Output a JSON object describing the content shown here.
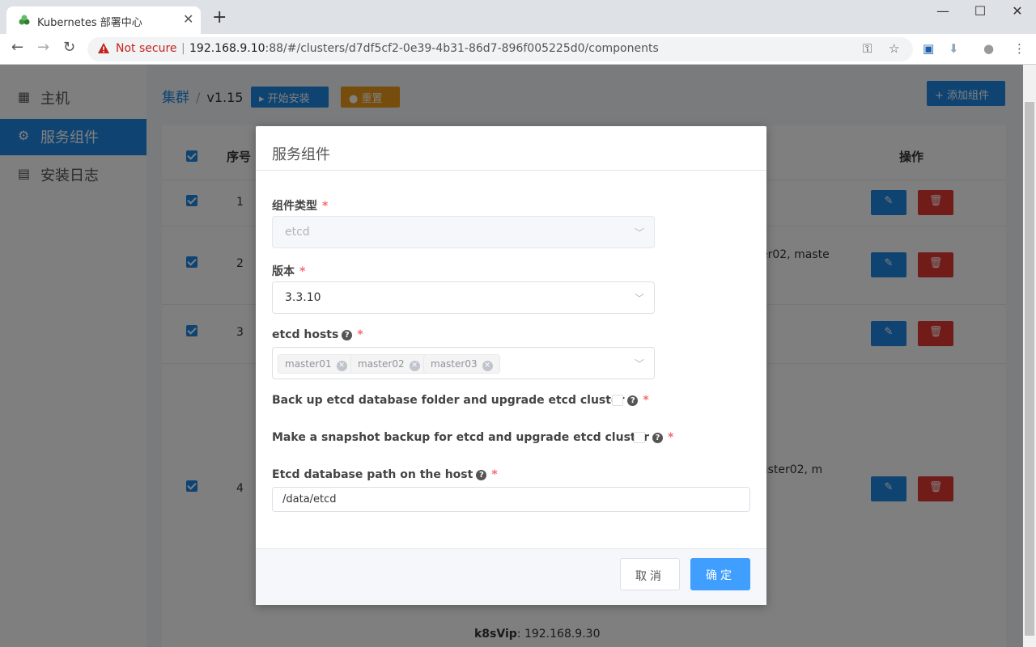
{
  "browser": {
    "tab_title": "Kubernetes 部署中心",
    "not_secure": "Not secure",
    "url_host": "192.168.9.10",
    "url_rest": ":88/#/clusters/d7df5cf2-0e39-4b31-86d7-896f005225d0/components"
  },
  "sidebar": {
    "items": [
      {
        "label": "主机",
        "icon": "grid-icon"
      },
      {
        "label": "服务组件",
        "icon": "gear-icon"
      },
      {
        "label": "安装日志",
        "icon": "document-icon"
      }
    ]
  },
  "header": {
    "crumb_root": "集群",
    "crumb_version": "v1.15",
    "install_label": "开始安装",
    "reset_label": "重置",
    "add_label": "添加组件"
  },
  "table": {
    "col_index": "序号",
    "col_actions": "操作",
    "rows": [
      {
        "index": "1",
        "text": ""
      },
      {
        "index": "2",
        "text": "er02, maste"
      },
      {
        "index": "3",
        "text": ""
      },
      {
        "index": "4",
        "text": "aster02, m"
      }
    ]
  },
  "footer": {
    "vip_label": "k8sVip",
    "vip_value": ": 192.168.9.30"
  },
  "dialog": {
    "title": "服务组件",
    "type_label": "组件类型",
    "type_value": "etcd",
    "version_label": "版本",
    "version_value": "3.3.10",
    "hosts_label": "etcd hosts",
    "hosts": [
      "master01",
      "master02",
      "master03"
    ],
    "backup_label": "Back up etcd database folder and upgrade etcd cluster",
    "snapshot_label": "Make a snapshot backup for etcd and upgrade etcd cluster",
    "path_label": "Etcd database path on the host",
    "path_value": "/data/etcd",
    "cancel_label": "取消",
    "ok_label": "确定"
  },
  "colors": {
    "primary": "#1e88e5",
    "warning": "#ef9a1a",
    "danger": "#e53935",
    "dialog_ok": "#409eff",
    "required": "#f56c6c"
  }
}
